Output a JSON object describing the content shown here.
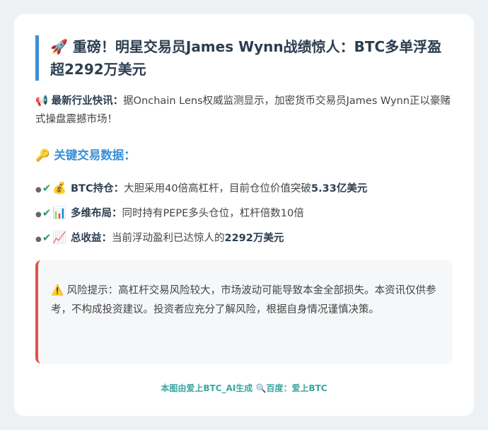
{
  "title": {
    "icon": "rocket-icon",
    "emoji": "🚀",
    "text": "重磅！明星交易员James Wynn战绩惊人：BTC多单浮盈超2292万美元"
  },
  "news": {
    "icon": "megaphone-icon",
    "emoji": "📢",
    "label": "最新行业快讯：",
    "text": "据Onchain Lens权威监测显示，加密货币交易员James Wynn正以豪赌式操盘震撼市场！"
  },
  "section": {
    "icon": "key-icon",
    "emoji": "🔑",
    "label": "关键交易数据："
  },
  "items": [
    {
      "icon": "money-bag-icon",
      "emoji": "💰",
      "label": "BTC持仓：",
      "text": "大胆采用40倍高杠杆，目前仓位价值突破",
      "highlight": "5.33亿美元"
    },
    {
      "icon": "bar-chart-icon",
      "emoji": "📊",
      "label": "多维布局：",
      "text": "同时持有PEPE多头仓位，杠杆倍数10倍",
      "highlight": ""
    },
    {
      "icon": "chart-increasing-icon",
      "emoji": "📈",
      "label": "总收益：",
      "text": "当前浮动盈利已达惊人的",
      "highlight": "2292万美元"
    }
  ],
  "check_mark": "✔",
  "warning": {
    "icon": "warning-icon",
    "emoji": "⚠️",
    "text": "风险提示：高杠杆交易风险较大，市场波动可能导致本金全部损失。本资讯仅供参考，不构成投资建议。投资者应充分了解风险，根据自身情况谨慎决策。"
  },
  "footer": {
    "text_before": "本图由爱上BTC_AI生成",
    "icon": "magnifier-icon",
    "emoji": "🔍",
    "text_after": "百度：爱上BTC"
  },
  "colors": {
    "accent_blue": "#3a8fd6",
    "warning_red": "#e0534a",
    "check_green": "#2e9b5f",
    "footer_teal": "#3aa6a0"
  }
}
